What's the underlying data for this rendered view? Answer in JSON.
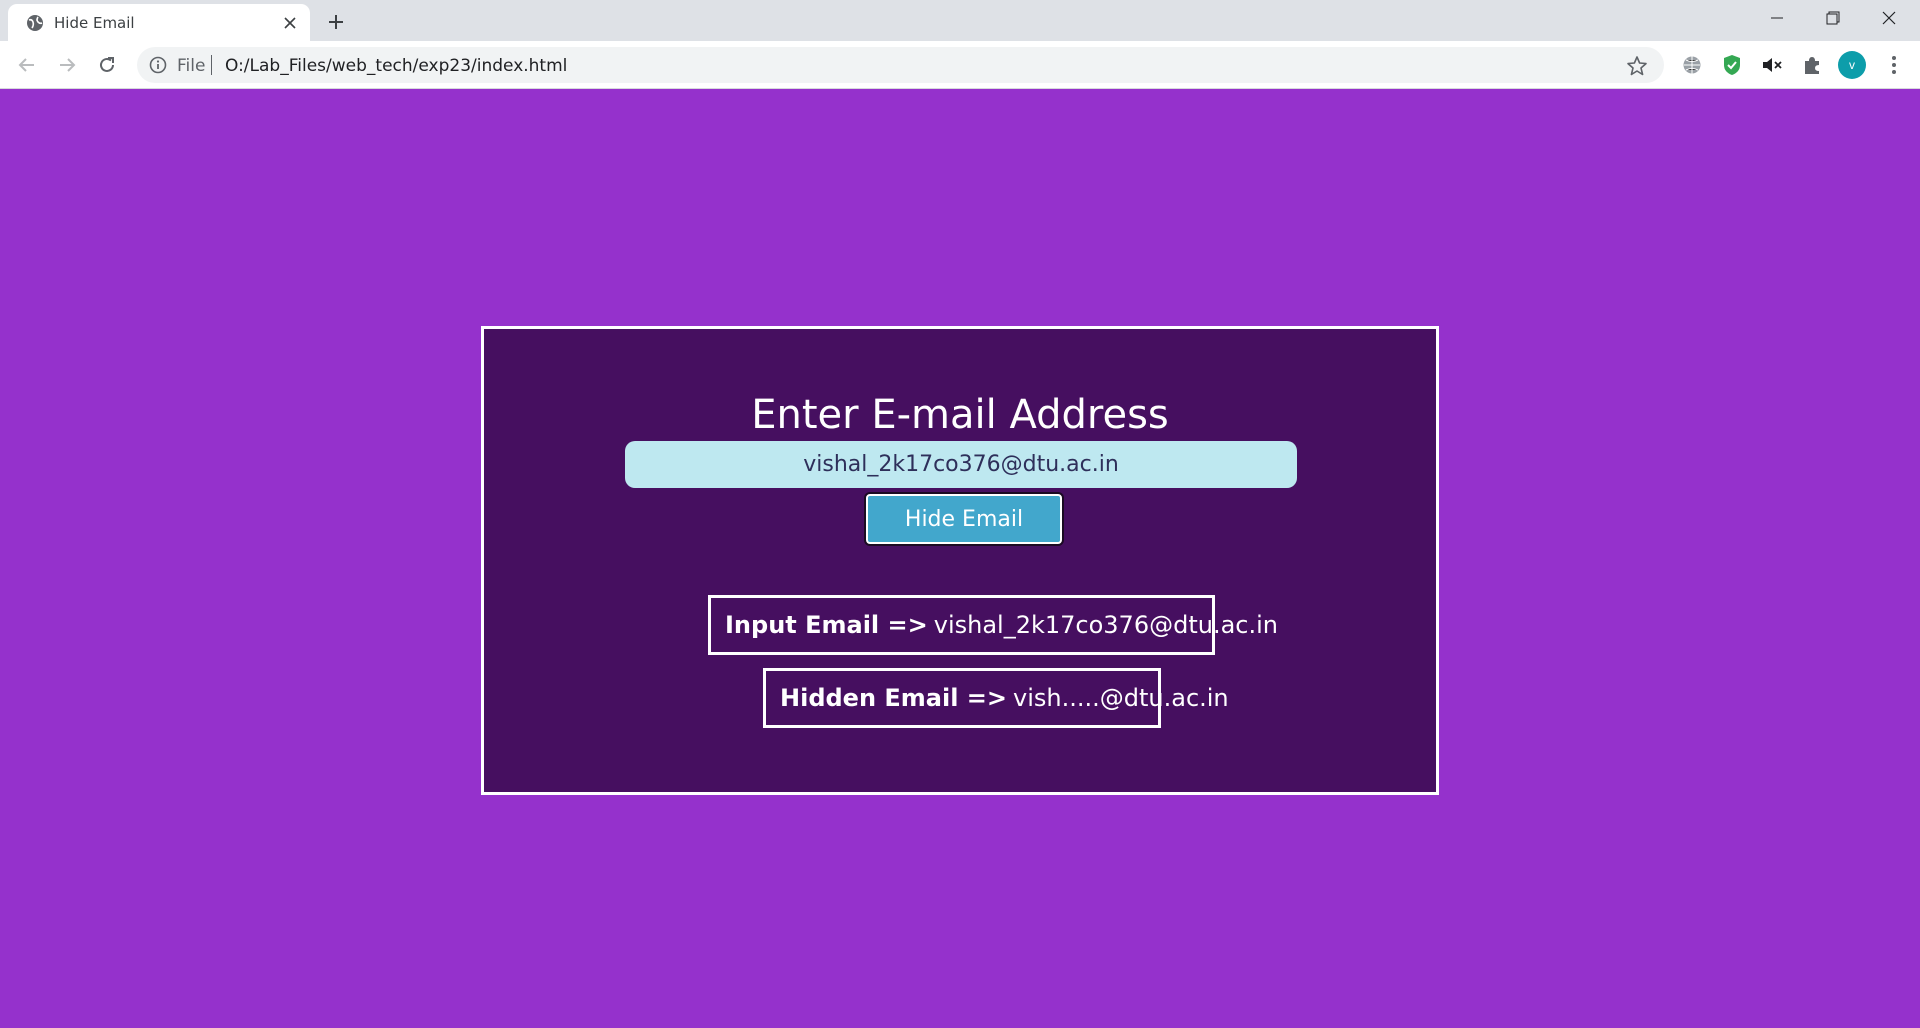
{
  "browser": {
    "tab_title": "Hide Email",
    "scheme_label": "File",
    "url": "O:/Lab_Files/web_tech/exp23/index.html",
    "profile_initial": "v",
    "profile_color": "#0d9daa"
  },
  "page": {
    "background": "#9531cc",
    "card_background": "#460f60",
    "heading": "Enter E-mail Address",
    "email_value": "vishal_2k17co376@dtu.ac.in",
    "button_label": "Hide Email",
    "button_color": "#42a7cc",
    "input_result_label": "Input Email =>",
    "input_result_value": "vishal_2k17co376@dtu.ac.in",
    "hidden_result_label": "Hidden Email =>",
    "hidden_result_value": "vish.....@dtu.ac.in"
  }
}
